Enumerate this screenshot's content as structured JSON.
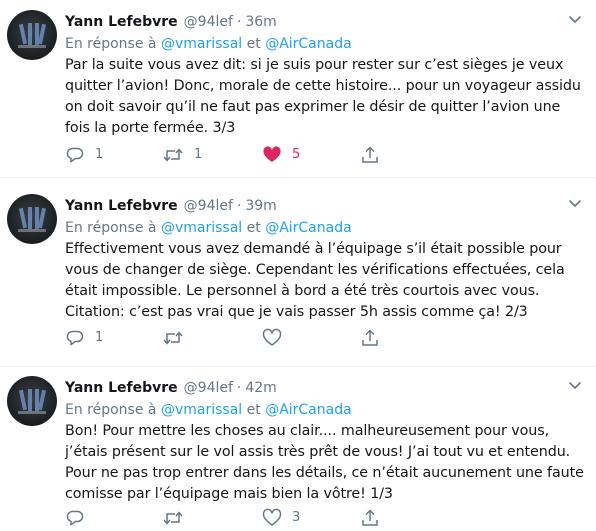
{
  "tweets": [
    {
      "author_name": "Yann Lefebvre",
      "handle": "@94lef",
      "separator": "·",
      "time": "36m",
      "reply_prefix": "En réponse à",
      "reply_mention_1": "@vmarissal",
      "reply_joiner": "et",
      "reply_mention_2": "@AirCanada",
      "text": "Par la suite vous avez dit: si je suis pour rester sur c’est sièges je veux quitter l’avion! Donc, morale de cette histoire... pour un voyageur assidu on doit savoir qu’il ne faut pas exprimer le désir de quitter l’avion une fois la porte fermée. 3/3",
      "reply_count": "1",
      "retweet_count": "1",
      "like_count": "5",
      "liked": true
    },
    {
      "author_name": "Yann Lefebvre",
      "handle": "@94lef",
      "separator": "·",
      "time": "39m",
      "reply_prefix": "En réponse à",
      "reply_mention_1": "@vmarissal",
      "reply_joiner": "et",
      "reply_mention_2": "@AirCanada",
      "text": "Effectivement vous avez demandé à l’équipage s’il était possible pour vous de changer de siège. Cependant les vérifications effectuées, cela était impossible. Le personnel à bord a été très courtois avec vous. Citation: c’est pas vrai que je vais passer 5h assis comme ça! 2/3",
      "reply_count": "1",
      "retweet_count": "",
      "like_count": "",
      "liked": false
    },
    {
      "author_name": "Yann Lefebvre",
      "handle": "@94lef",
      "separator": "·",
      "time": "42m",
      "reply_prefix": "En réponse à",
      "reply_mention_1": "@vmarissal",
      "reply_joiner": "et",
      "reply_mention_2": "@AirCanada",
      "text": "Bon! Pour mettre les choses au clair.... malheureusement pour vous, j’étais présent sur le vol assis très prêt de vous! J’ai tout vu et entendu. Pour ne pas trop entrer dans les détails, ce n’était aucunement une faute comisse par l’équipage mais bien la vôtre! 1/3",
      "reply_count": "",
      "retweet_count": "",
      "like_count": "3",
      "liked": false
    }
  ],
  "colors": {
    "accent": "#1da1f2",
    "like": "#e0245e",
    "muted": "#657786",
    "text": "#14171a",
    "divider": "#e6ecf0"
  },
  "icons": {
    "avatar": "avatar-logo",
    "menu": "chevron-down-icon",
    "reply": "reply-icon",
    "retweet": "retweet-icon",
    "like": "heart-icon",
    "share": "share-icon"
  }
}
